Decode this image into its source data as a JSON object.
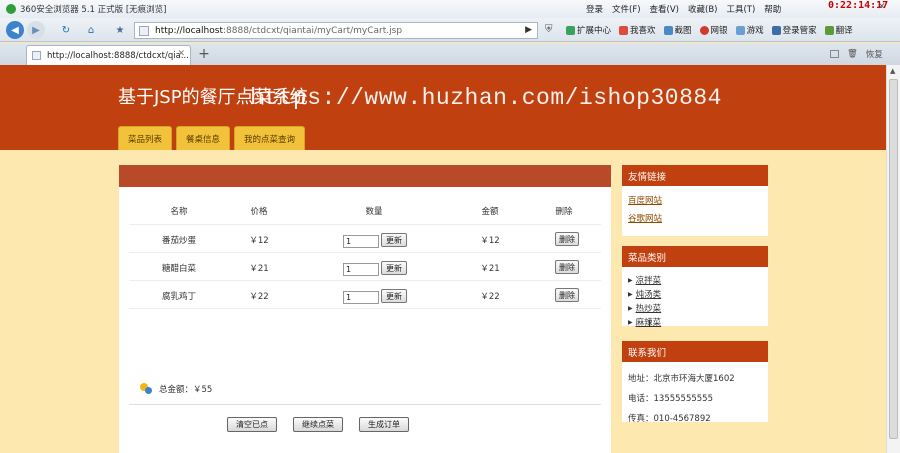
{
  "browser": {
    "title": "360安全浏览器 5.1 正式版 [无痕浏览]",
    "menus": [
      "登录",
      "文件(F)",
      "查看(V)",
      "收藏(B)",
      "工具(T)",
      "帮助"
    ],
    "clock": "0:22:14:17",
    "url_host": "http://localhost",
    "url_path": ":8888/ctdcxt/qiantai/myCart/myCart.jsp",
    "toolbar_items": [
      "扩展中心",
      "我喜欢",
      "截图",
      "网银",
      "游戏",
      "登录管家",
      "翻译"
    ],
    "tab_title": "http://localhost:8888/ctdcxt/qia...",
    "tab_right": "恢复"
  },
  "header": {
    "site_title": "基于JSP的餐厅点菜系统",
    "watermark": "https://www.huzhan.com/ishop30884",
    "menu": [
      "菜品列表",
      "餐桌信息",
      "我的点菜查询"
    ]
  },
  "cart": {
    "columns": [
      "名称",
      "价格",
      "数量",
      "金额",
      "删除"
    ],
    "rows": [
      {
        "name": "番茄炒蛋",
        "price": "￥12",
        "qty": "1",
        "amount": "￥12"
      },
      {
        "name": "糖醋白菜",
        "price": "￥21",
        "qty": "1",
        "amount": "￥21"
      },
      {
        "name": "腐乳鸡丁",
        "price": "￥22",
        "qty": "1",
        "amount": "￥22"
      }
    ],
    "update_label": "更新",
    "delete_label": "删除",
    "total": "总金额：￥55",
    "actions": [
      "清空已点",
      "继续点菜",
      "生成订单"
    ]
  },
  "sidebar": {
    "links_title": "友情链接",
    "links": [
      "百度网站",
      "谷歌网站"
    ],
    "categories_title": "菜品类别",
    "categories": [
      "凉拌菜",
      "炖汤类",
      "热炒菜",
      "麻辣菜"
    ],
    "contact_title": "联系我们",
    "contact": [
      "地址：北京市环海大厦1602",
      "电话：13555555555",
      "传真：010-4567892"
    ]
  }
}
